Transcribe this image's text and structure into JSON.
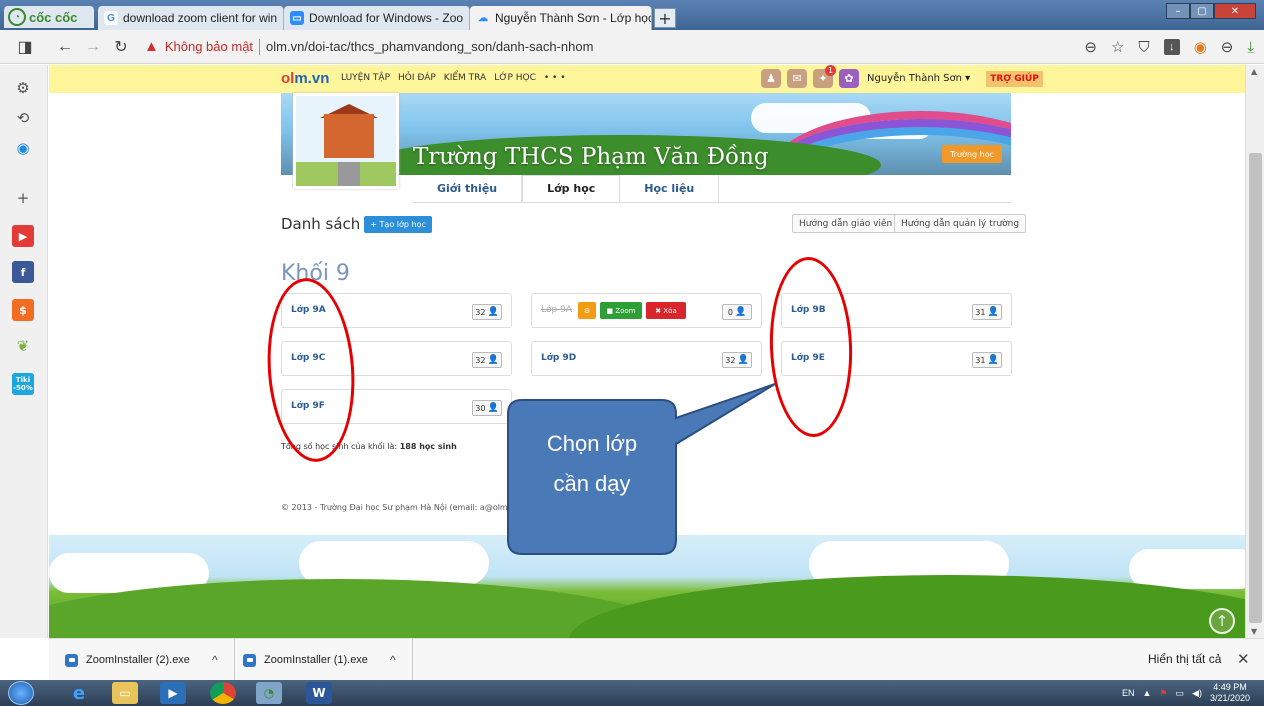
{
  "browser": {
    "brand": "cốc cốc",
    "tabs": [
      {
        "label": "download zoom client for win",
        "favicon": "google-icon"
      },
      {
        "label": "Download for Windows - Zoo",
        "favicon": "zoom-icon"
      },
      {
        "label": "Nguyễn Thành Sơn - Lớp học",
        "favicon": "olm-icon"
      }
    ],
    "new_tab": "+",
    "security_label": "Không bảo mật",
    "url": "olm.vn/doi-tac/thcs_phamvandong_son/danh-sach-nhom"
  },
  "olm": {
    "logo_o": "ol",
    "logo_rest": "m.vn",
    "menu": [
      "LUYỆN TẬP",
      "HỎI ĐÁP",
      "KIỂM TRA",
      "LỚP HỌC",
      "• • •"
    ],
    "notif_count": "1",
    "user": "Nguyễn Thành Sơn ▾",
    "help": "TRỢ GIÚP"
  },
  "school": {
    "name": "Trường THCS Phạm Văn Đồng",
    "badge": "Trường học",
    "tabs": [
      "Giới thiệu",
      "Lớp học",
      "Học liệu"
    ]
  },
  "list": {
    "heading": "Danh sách",
    "create_button": "+ Tạo lớp học",
    "guide_teacher": "Hướng dẫn giáo viên",
    "guide_admin": "Hướng dẫn quản lý trường",
    "grade": "Khối 9",
    "classes": [
      {
        "name": "Lớp 9A",
        "count": "32"
      },
      {
        "name": "Lớp 9A",
        "count": "0"
      },
      {
        "name": "Lớp 9B",
        "count": "31"
      },
      {
        "name": "Lớp 9C",
        "count": "32"
      },
      {
        "name": "Lớp 9D",
        "count": "32"
      },
      {
        "name": "Lớp 9E",
        "count": "31"
      },
      {
        "name": "Lớp 9F",
        "count": "30"
      }
    ],
    "zoom_button": "Zoom",
    "delete_button": "Xóa",
    "total_prefix": "Tổng số học sinh của khối là: ",
    "total_value": "188 học sinh",
    "footer": "© 2013 - Trường Đại học Sư phạm Hà Nội (email: a@olm."
  },
  "annotation": {
    "callout_line1": "Chọn lớp",
    "callout_line2": "cần dạy"
  },
  "downloads": {
    "items": [
      "ZoomInstaller (2).exe",
      "ZoomInstaller (1).exe"
    ],
    "show_all": "Hiển thị tất cả"
  },
  "taskbar": {
    "lang": "EN",
    "time": "4:49 PM",
    "date": "3/21/2020"
  },
  "sidebar_badge": "Tiki\n-50%"
}
